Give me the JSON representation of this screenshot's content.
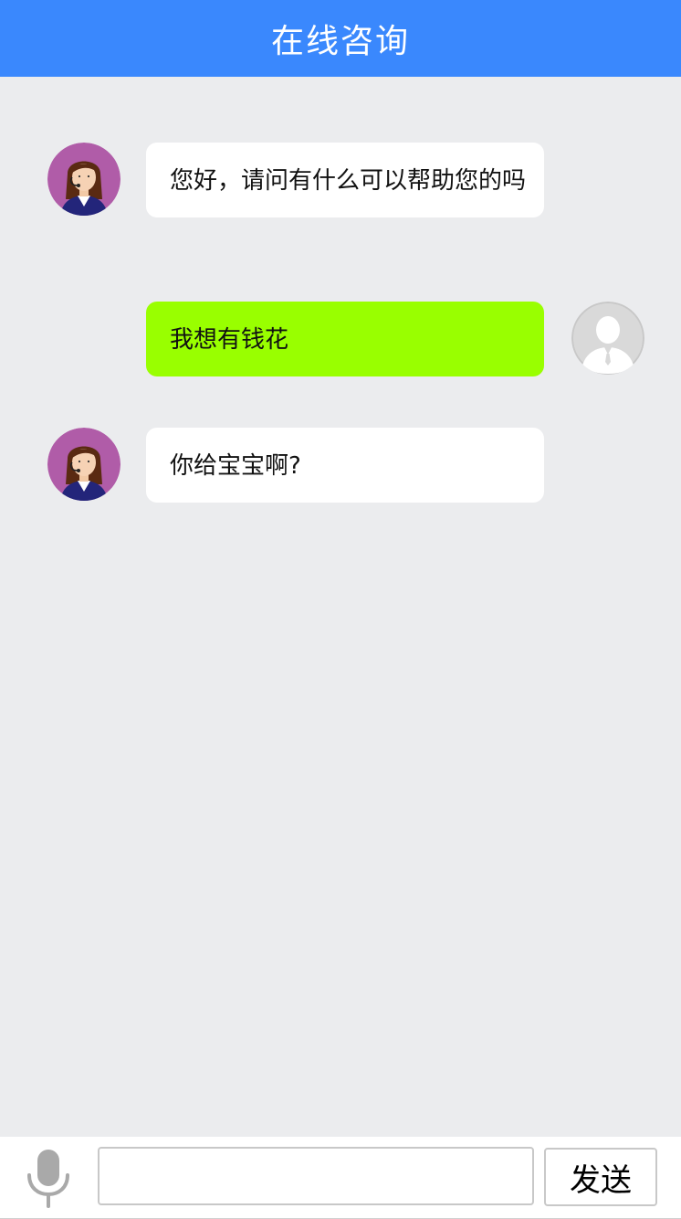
{
  "header": {
    "title": "在线咨询"
  },
  "messages": [
    {
      "from": "agent",
      "avatar": "customer-service-agent-avatar",
      "text": "您好，请问有什么可以帮助您的吗"
    },
    {
      "from": "user",
      "avatar": "user-avatar",
      "text": "我想有钱花"
    },
    {
      "from": "agent",
      "avatar": "customer-service-agent-avatar",
      "text": "你给宝宝啊?"
    }
  ],
  "footer": {
    "mic_icon": "microphone-icon",
    "input_value": "",
    "input_placeholder": "",
    "send_label": "发送"
  },
  "colors": {
    "header_bg": "#3A88FD",
    "page_bg": "#EBECEE",
    "agent_bubble": "#FFFFFF",
    "user_bubble": "#99FF00",
    "agent_avatar_bg": "#B05CA8",
    "user_avatar_bg": "#D9D9D9"
  }
}
